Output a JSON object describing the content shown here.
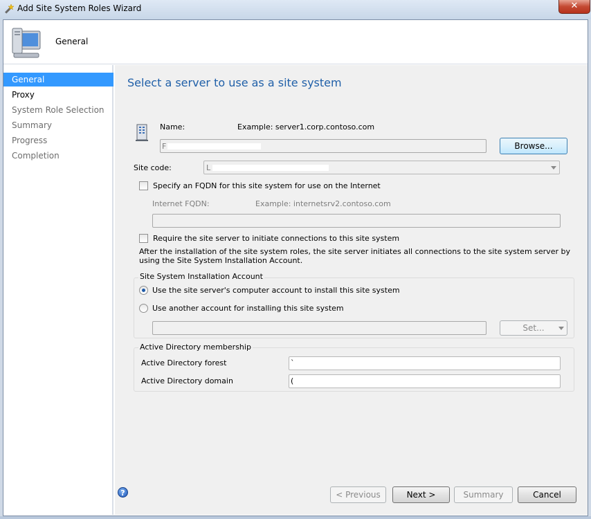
{
  "window": {
    "title": "Add Site System Roles Wizard",
    "close_glyph": "✕"
  },
  "header": {
    "title": "General",
    "icon": "computer-icon"
  },
  "nav": {
    "items": [
      {
        "label": "General",
        "state": "active"
      },
      {
        "label": "Proxy",
        "state": "enabled"
      },
      {
        "label": "System Role Selection",
        "state": "disabled"
      },
      {
        "label": "Summary",
        "state": "disabled"
      },
      {
        "label": "Progress",
        "state": "disabled"
      },
      {
        "label": "Completion",
        "state": "disabled"
      }
    ]
  },
  "page": {
    "heading": "Select a server to use as a site system",
    "name_label": "Name:",
    "name_example": "Example: server1.corp.contoso.com",
    "name_value": "F",
    "browse_label": "Browse...",
    "site_code_label": "Site code:",
    "site_code_value": "L",
    "fqdn_checkbox_label": "Specify an FQDN for this site system for use on the Internet",
    "fqdn_checked": false,
    "internet_fqdn_label": "Internet FQDN:",
    "internet_fqdn_example": "Example: internetsrv2.contoso.com",
    "internet_fqdn_value": "",
    "require_checkbox_label": "Require the site server to initiate connections to this site system",
    "require_checked": false,
    "require_description": "After the  installation of the site system roles, the site server initiates all connections to the site system server by using the Site System Installation Account.",
    "install_account_group": "Site System Installation Account",
    "radio_computer_account": "Use the site server's computer account to install this site system",
    "radio_another_account": "Use another account for installing this site system",
    "selected_radio": "computer_account",
    "account_value": "",
    "set_label": "Set...",
    "ad_group": "Active Directory membership",
    "ad_forest_label": "Active Directory forest",
    "ad_forest_value": "`",
    "ad_domain_label": "Active Directory domain",
    "ad_domain_value": "("
  },
  "footer": {
    "help_glyph": "?",
    "previous_label": "< Previous",
    "next_label": "Next >",
    "summary_label": "Summary",
    "cancel_label": "Cancel"
  }
}
